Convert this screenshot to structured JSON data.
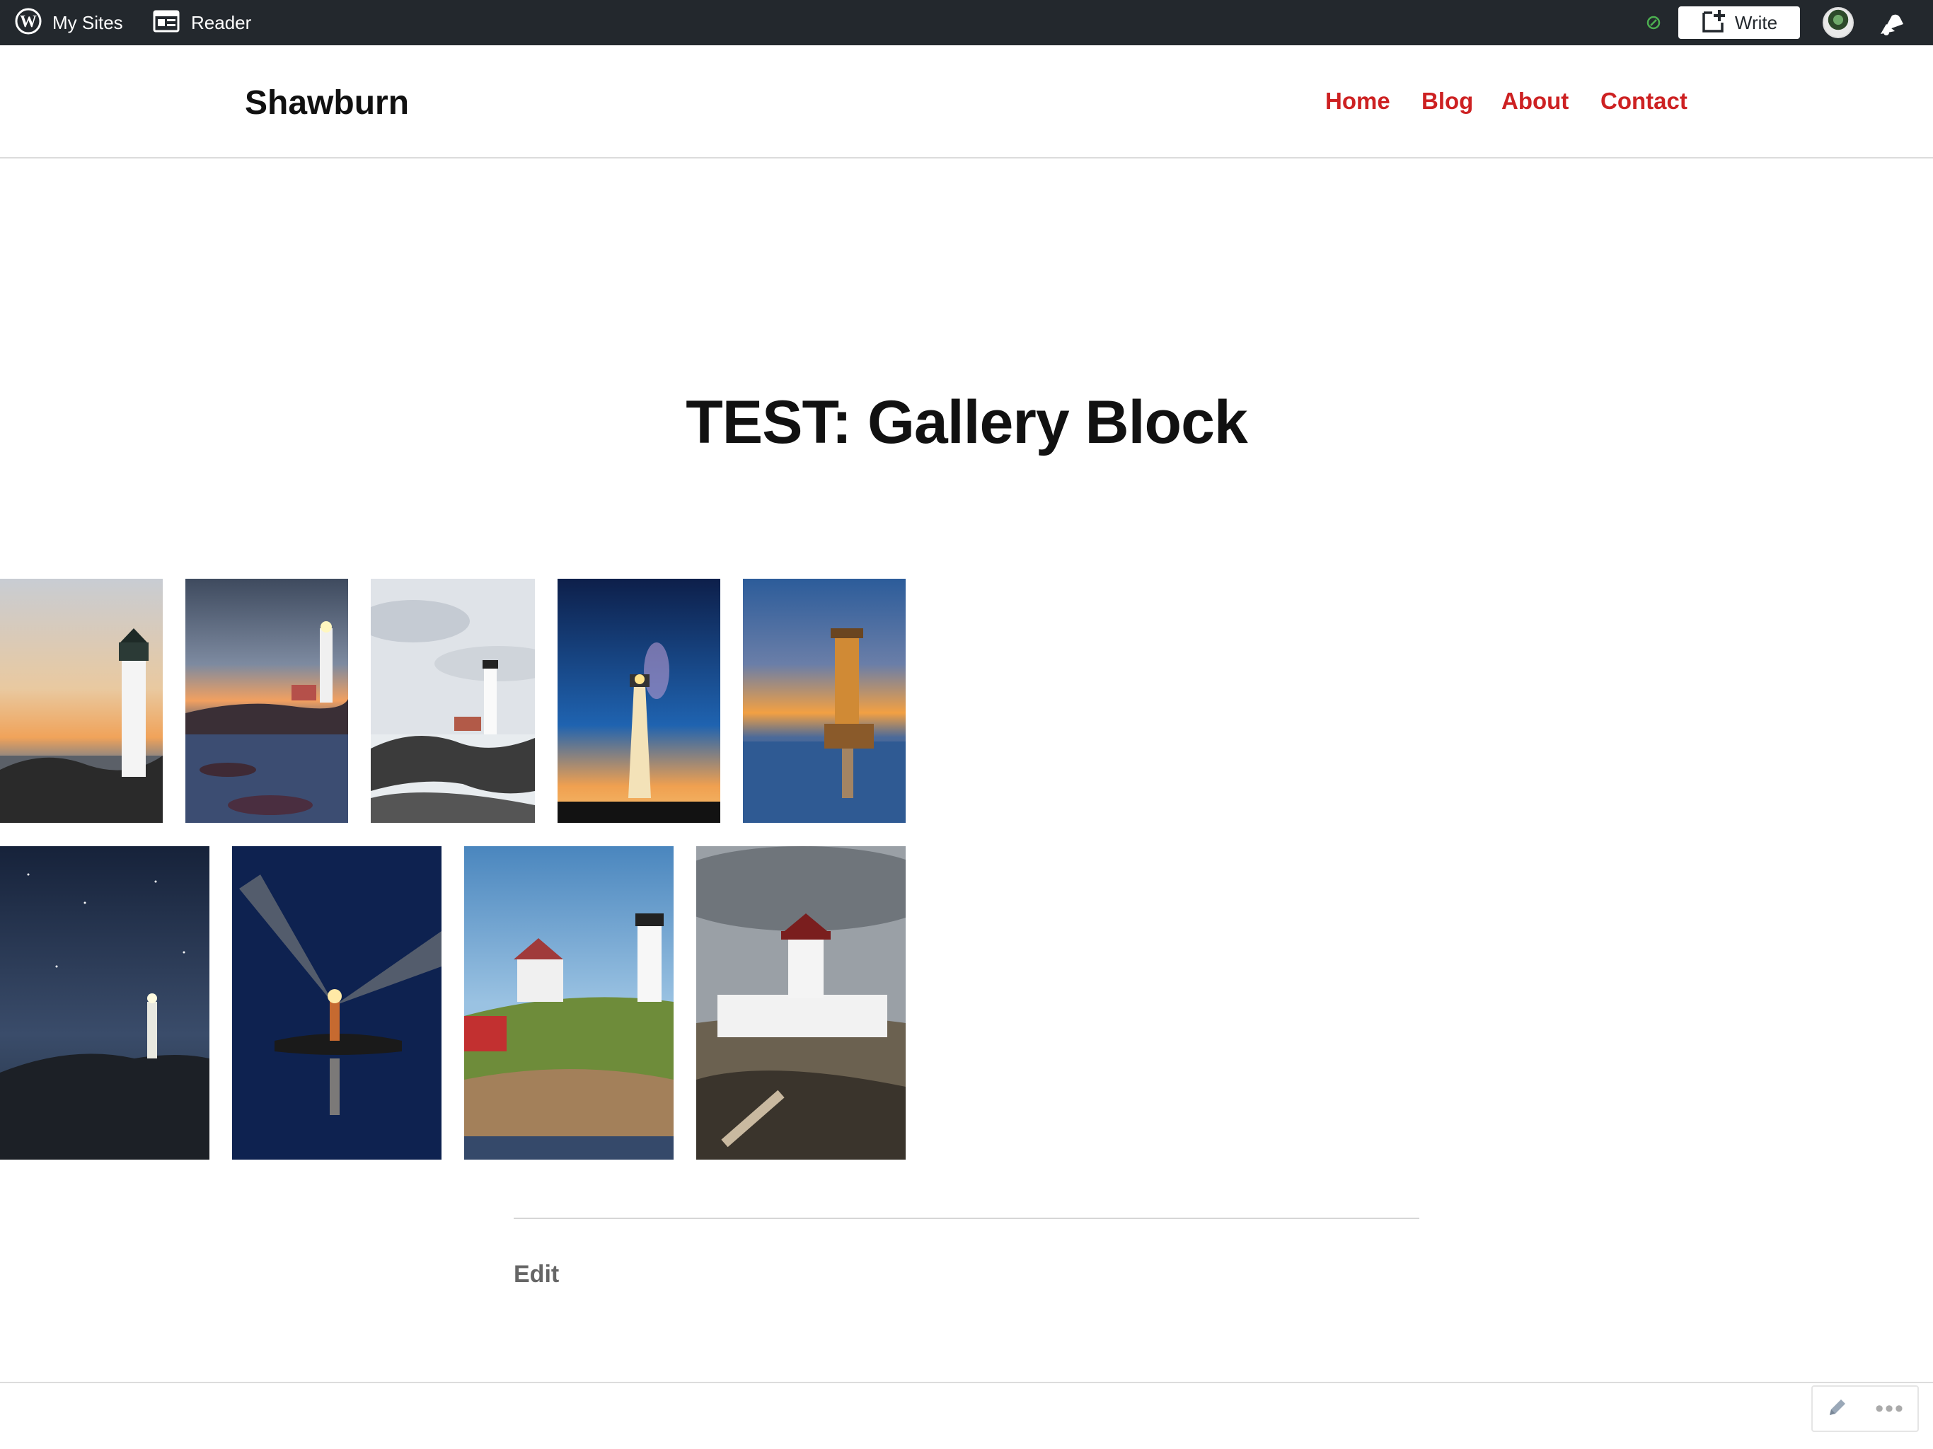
{
  "admin_bar": {
    "my_sites_label": "My Sites",
    "reader_label": "Reader",
    "write_label": "Write"
  },
  "header": {
    "site_title": "Shawburn",
    "nav": [
      "Home",
      "Blog",
      "About",
      "Contact"
    ]
  },
  "page": {
    "title": "TEST: Gallery Block",
    "edit_label": "Edit"
  },
  "gallery": {
    "row1": [
      "lighthouse-sunset-rocks",
      "lighthouse-dusk-coast",
      "lighthouse-cloudy-shore",
      "lighthouse-night-stars",
      "lighthouse-harbor-sunset"
    ],
    "row2": [
      "lighthouse-night-cliff",
      "lighthouse-beam-reflection",
      "lighthouse-cape-house",
      "lighthouse-stormy-beach"
    ]
  },
  "colors": {
    "admin_bar_bg": "#23282d",
    "nav_link": "#cd2122",
    "status_dot": "#4caf50"
  }
}
